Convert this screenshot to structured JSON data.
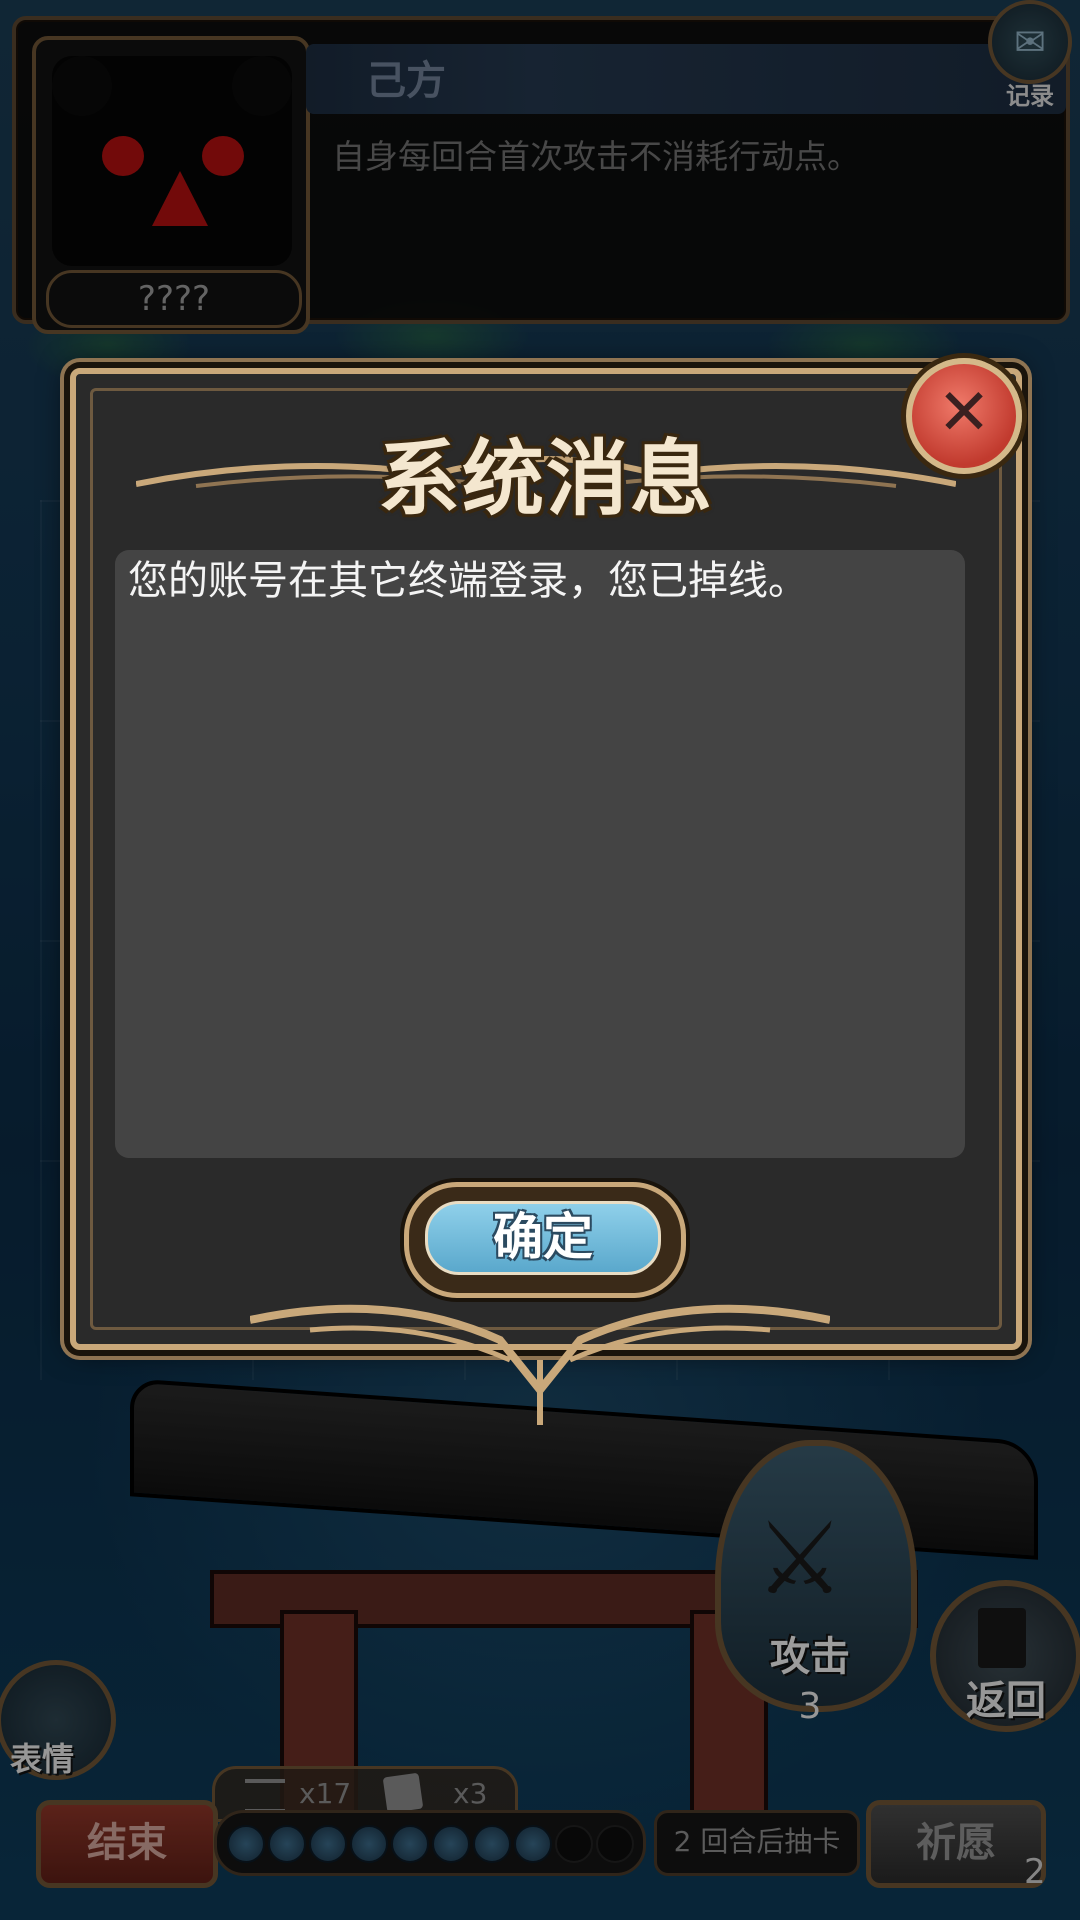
{
  "opponent": {
    "name": "????",
    "side_label": "己方",
    "effect_text": "自身每回合首次攻击不消耗行动点。"
  },
  "record_button": {
    "label": "记录"
  },
  "dialog": {
    "title": "系统消息",
    "message": "您的账号在其它终端登录，您已掉线。",
    "confirm_label": "确定",
    "close_icon": "close-icon"
  },
  "hud": {
    "attack_label": "攻击",
    "attack_count": "3",
    "return_label": "返回",
    "emote_label": "表情",
    "deck_count": "x17",
    "hand_count": "x3",
    "end_label": "结束",
    "action_points": {
      "filled": 8,
      "total": 10
    },
    "draw_info": "2 回合后抽卡",
    "pray_label": "祈愿",
    "pray_count": "2"
  },
  "colors": {
    "dialog_border": "#c9a87a",
    "close_button": "#d9574a",
    "confirm_button": "#7cc0e0"
  }
}
